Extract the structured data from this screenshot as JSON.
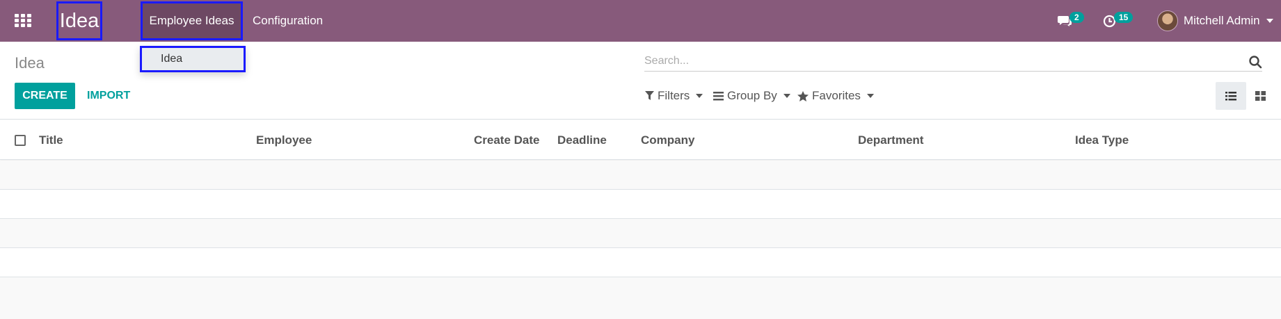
{
  "navbar": {
    "brand": "Idea",
    "menus": [
      {
        "label": "Employee Ideas"
      },
      {
        "label": "Configuration"
      }
    ],
    "chat_badge": "2",
    "activity_badge": "15",
    "user_name": "Mitchell Admin",
    "color": "#875a7b"
  },
  "dropdown": {
    "items": [
      {
        "label": "Idea"
      }
    ]
  },
  "control_panel": {
    "breadcrumb": "Idea",
    "create_label": "CREATE",
    "import_label": "IMPORT",
    "search_placeholder": "Search...",
    "filters_label": "Filters",
    "groupby_label": "Group By",
    "favorites_label": "Favorites",
    "accent_color": "#00a09d"
  },
  "list": {
    "columns": [
      {
        "label": "Title"
      },
      {
        "label": "Employee"
      },
      {
        "label": "Create Date"
      },
      {
        "label": "Deadline"
      },
      {
        "label": "Company"
      },
      {
        "label": "Department"
      },
      {
        "label": "Idea Type"
      }
    ],
    "rows": []
  },
  "icons": [
    "apps-grid-icon",
    "chat-icon",
    "clock-icon",
    "search-icon",
    "filter-icon",
    "bars-icon",
    "star-icon",
    "list-view-icon",
    "kanban-view-icon"
  ]
}
